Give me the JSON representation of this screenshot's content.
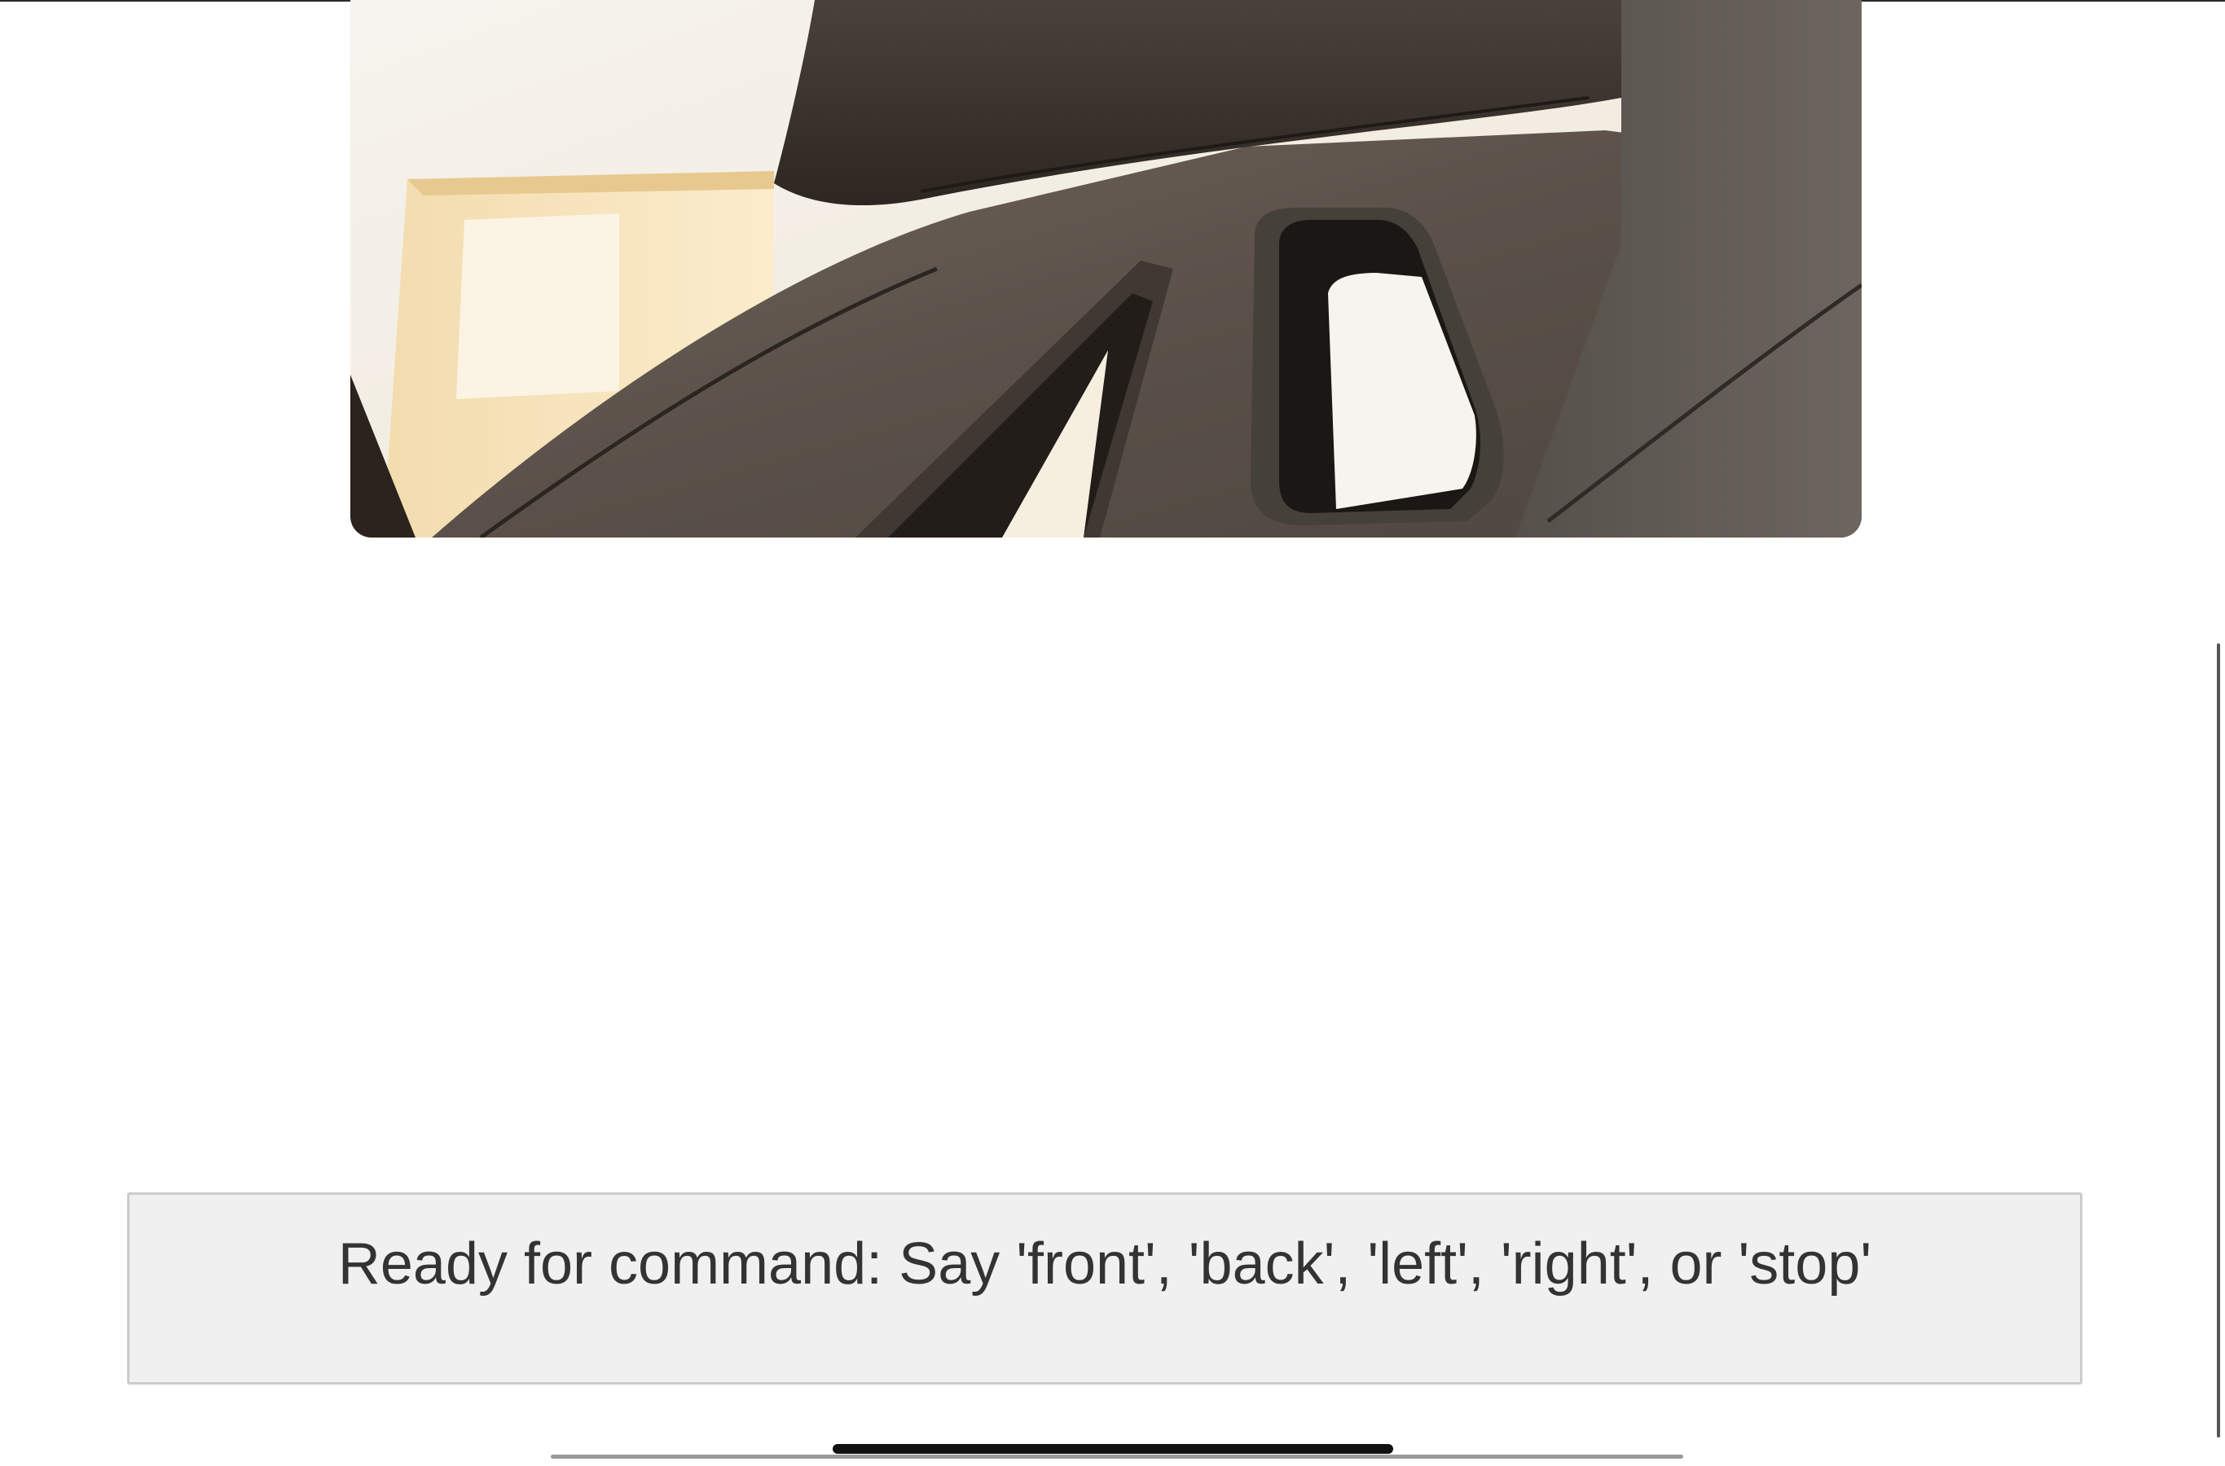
{
  "camera": {
    "image_description_icon": "chair-headrest-camera-view"
  },
  "status": {
    "message": "Ready for command: Say 'front', 'back', 'left', 'right', or 'stop'"
  },
  "colors": {
    "status_background": "#f0f0f0",
    "status_border": "#cccccc",
    "status_text": "#333333",
    "home_indicator": "#111111"
  }
}
